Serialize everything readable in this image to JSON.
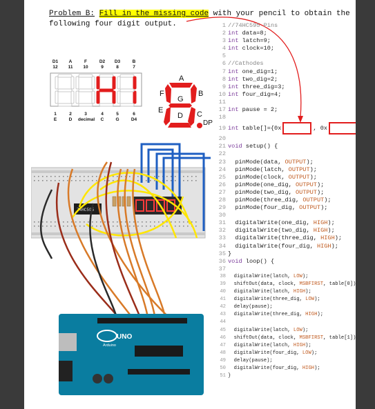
{
  "problem": {
    "label": "Problem B:",
    "highlight": "Fill in the missing code",
    "rest": " with your pencil to obtain the",
    "line2": "following four digit output."
  },
  "display_pins": {
    "top_names": [
      "D1",
      "A",
      "F",
      "D2",
      "D3",
      "B"
    ],
    "top_nums": [
      "12",
      "11",
      "10",
      "9",
      "8",
      "7"
    ],
    "bottom_nums": [
      "1",
      "2",
      "3",
      "4",
      "5",
      "6"
    ],
    "bottom_names": [
      "E",
      "D",
      "decimal",
      "C",
      "G",
      "D4"
    ],
    "digits_shown": "HI"
  },
  "segment_labels": {
    "a": "A",
    "b": "B",
    "c": "C",
    "d": "D",
    "e": "E",
    "f": "F",
    "g": "G",
    "dp": "DP"
  },
  "breadboard": {
    "chip_label": "74HC595",
    "arduino_label": "UNO",
    "arduino_brand": "Arduino"
  },
  "code": [
    {
      "n": "1",
      "t": "//74HC595 Pins"
    },
    {
      "n": "2",
      "t": "int data=8;"
    },
    {
      "n": "3",
      "t": "int latch=9;"
    },
    {
      "n": "4",
      "t": "int clock=10;"
    },
    {
      "n": "5",
      "t": ""
    },
    {
      "n": "6",
      "t": "//Cathodes"
    },
    {
      "n": "7",
      "t": "int one_dig=1;"
    },
    {
      "n": "8",
      "t": "int two_dig=2;"
    },
    {
      "n": "9",
      "t": "int three_dig=3;"
    },
    {
      "n": "10",
      "t": "int four_dig=4;"
    },
    {
      "n": "11",
      "t": ""
    },
    {
      "n": "17",
      "t": "int pause = 2;"
    },
    {
      "n": "18",
      "t": ""
    },
    {
      "n": "19",
      "t": "int table[]={0x"
    },
    {
      "n": "20",
      "t": ""
    },
    {
      "n": "21",
      "t": "void setup() {"
    },
    {
      "n": "22",
      "t": ""
    },
    {
      "n": "23",
      "t": "  pinMode(data, OUTPUT);"
    },
    {
      "n": "24",
      "t": "  pinMode(latch, OUTPUT);"
    },
    {
      "n": "25",
      "t": "  pinMode(clock, OUTPUT);"
    },
    {
      "n": "26",
      "t": "  pinMode(one_dig, OUTPUT);"
    },
    {
      "n": "27",
      "t": "  pinMode(two_dig, OUTPUT);"
    },
    {
      "n": "28",
      "t": "  pinMode(three_dig, OUTPUT);"
    },
    {
      "n": "29",
      "t": "  pinMode(four_dig, OUTPUT);"
    },
    {
      "n": "30",
      "t": ""
    },
    {
      "n": "31",
      "t": "  digitalWrite(one_dig, HIGH);"
    },
    {
      "n": "32",
      "t": "  digitalWrite(two_dig, HIGH);"
    },
    {
      "n": "33",
      "t": "  digitalWrite(three_dig, HIGH);"
    },
    {
      "n": "34",
      "t": "  digitalWrite(four_dig, HIGH);"
    },
    {
      "n": "35",
      "t": "}"
    },
    {
      "n": "36",
      "t": "void loop() {"
    },
    {
      "n": "37",
      "t": ""
    },
    {
      "n": "38",
      "t": "  digitalWrite(latch, LOW);"
    },
    {
      "n": "39",
      "t": "  shiftOut(data, clock, MSBFIRST, table[0]);"
    },
    {
      "n": "40",
      "t": "  digitalWrite(latch, HIGH);"
    },
    {
      "n": "41",
      "t": "  digitalWrite(three_dig, LOW);"
    },
    {
      "n": "42",
      "t": "  delay(pause);"
    },
    {
      "n": "43",
      "t": "  digitalWrite(three_dig, HIGH);"
    },
    {
      "n": "44",
      "t": ""
    },
    {
      "n": "45",
      "t": "  digitalWrite(latch, LOW);"
    },
    {
      "n": "46",
      "t": "  shiftOut(data, clock, MSBFIRST, table[1]);"
    },
    {
      "n": "47",
      "t": "  digitalWrite(latch, HIGH);"
    },
    {
      "n": "48",
      "t": "  digitalWrite(four_dig, LOW);"
    },
    {
      "n": "49",
      "t": "  delay(pause);"
    },
    {
      "n": "50",
      "t": "  digitalWrite(four_dig, HIGH);"
    },
    {
      "n": "51",
      "t": "}"
    }
  ],
  "table_mid": ", 0x",
  "table_end": "};",
  "colors": {
    "accent_red": "#e21d1d",
    "highlight": "#ffff00",
    "arduino_blue": "#0a7da0"
  }
}
